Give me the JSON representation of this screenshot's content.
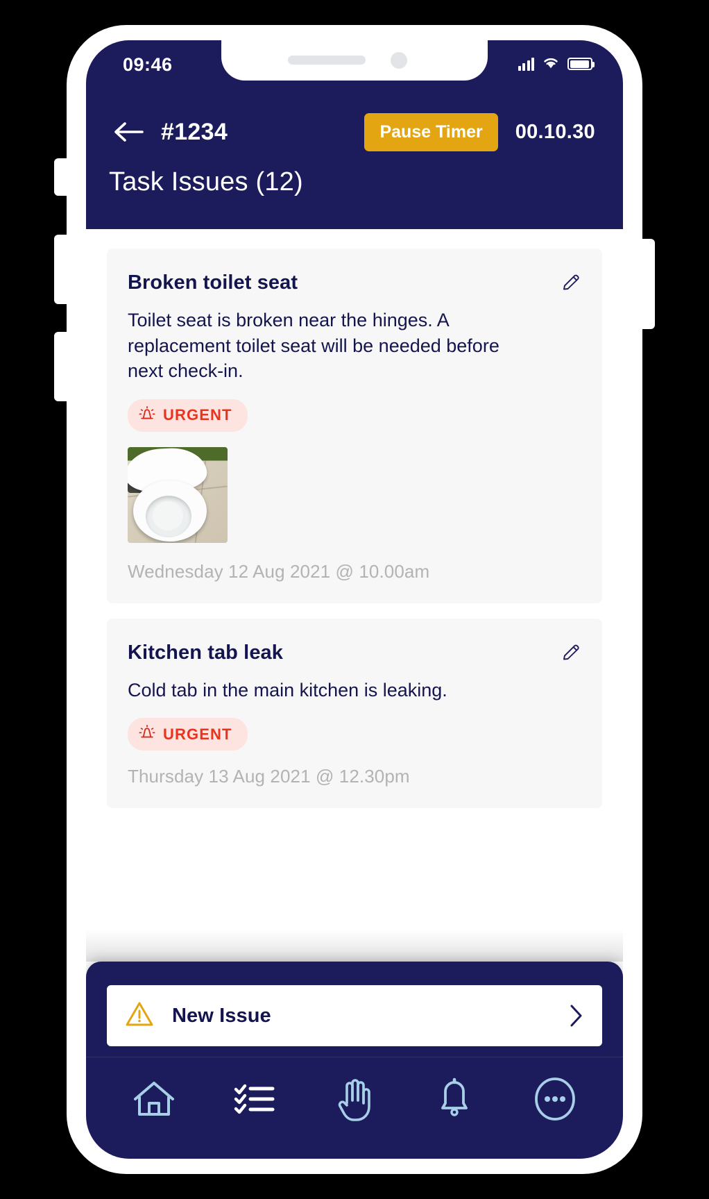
{
  "status_bar": {
    "time": "09:46",
    "signal_icon": "signal-bars-icon",
    "wifi_icon": "wifi-icon",
    "battery_icon": "battery-full-icon"
  },
  "header": {
    "back_icon": "back-arrow-icon",
    "task_id": "#1234",
    "pause_timer_label": "Pause Timer",
    "timer_value": "00.10.30",
    "page_title": "Task Issues (12)",
    "background_color": "#1c1c5c",
    "accent_color": "#e3a612"
  },
  "issues": [
    {
      "title": "Broken toilet seat",
      "description": "Toilet seat is broken near the hinges. A replacement toilet seat will be needed before next check-in.",
      "badge": "URGENT",
      "badge_icon": "siren-alert-icon",
      "badge_color": "#e8341f",
      "badge_background": "#fde4e0",
      "edit_icon": "pencil-edit-icon",
      "has_photo": true,
      "photo_alt": "broken-toilet-seat-photo",
      "date": "Wednesday 12 Aug 2021 @ 10.00am"
    },
    {
      "title": "Kitchen tab leak",
      "description": "Cold tab in the main kitchen is leaking.",
      "badge": "URGENT",
      "badge_icon": "siren-alert-icon",
      "badge_color": "#e8341f",
      "badge_background": "#fde4e0",
      "edit_icon": "pencil-edit-icon",
      "has_photo": false,
      "date": "Thursday 13 Aug 2021 @ 12.30pm"
    }
  ],
  "dock": {
    "new_issue_label": "New Issue",
    "new_issue_icon": "warning-triangle-icon",
    "chevron_icon": "chevron-right-icon"
  },
  "tabbar": {
    "items": [
      {
        "name": "home",
        "icon": "home-icon"
      },
      {
        "name": "tasks",
        "icon": "checklist-icon"
      },
      {
        "name": "hand",
        "icon": "hand-raised-icon"
      },
      {
        "name": "notifications",
        "icon": "bell-icon"
      },
      {
        "name": "more",
        "icon": "more-ellipsis-icon"
      }
    ]
  }
}
